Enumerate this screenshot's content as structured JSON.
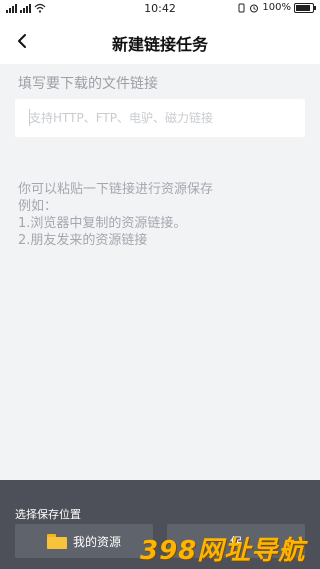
{
  "status_bar": {
    "time": "10:42",
    "battery": "100%",
    "battery_level": 1.0
  },
  "header": {
    "title": "新建链接任务",
    "back_icon": "chevron-left-icon"
  },
  "form": {
    "label": "填写要下载的文件链接",
    "input_value": "",
    "input_placeholder": "支持HTTP、FTP、电驴、磁力链接"
  },
  "hints": {
    "line1": "你可以粘贴一下链接进行资源保存",
    "line2": "例如：",
    "line3": "1.浏览器中复制的资源链接。",
    "line4": "2.朋友发来的资源链接"
  },
  "bottom": {
    "save_location_label": "选择保存位置",
    "my_resources_label": "我的资源",
    "my_resources_icon": "folder-icon",
    "save_button_label": "保",
    "folder_color": "#f6c33a"
  },
  "watermark": {
    "text": "398网址导航"
  }
}
